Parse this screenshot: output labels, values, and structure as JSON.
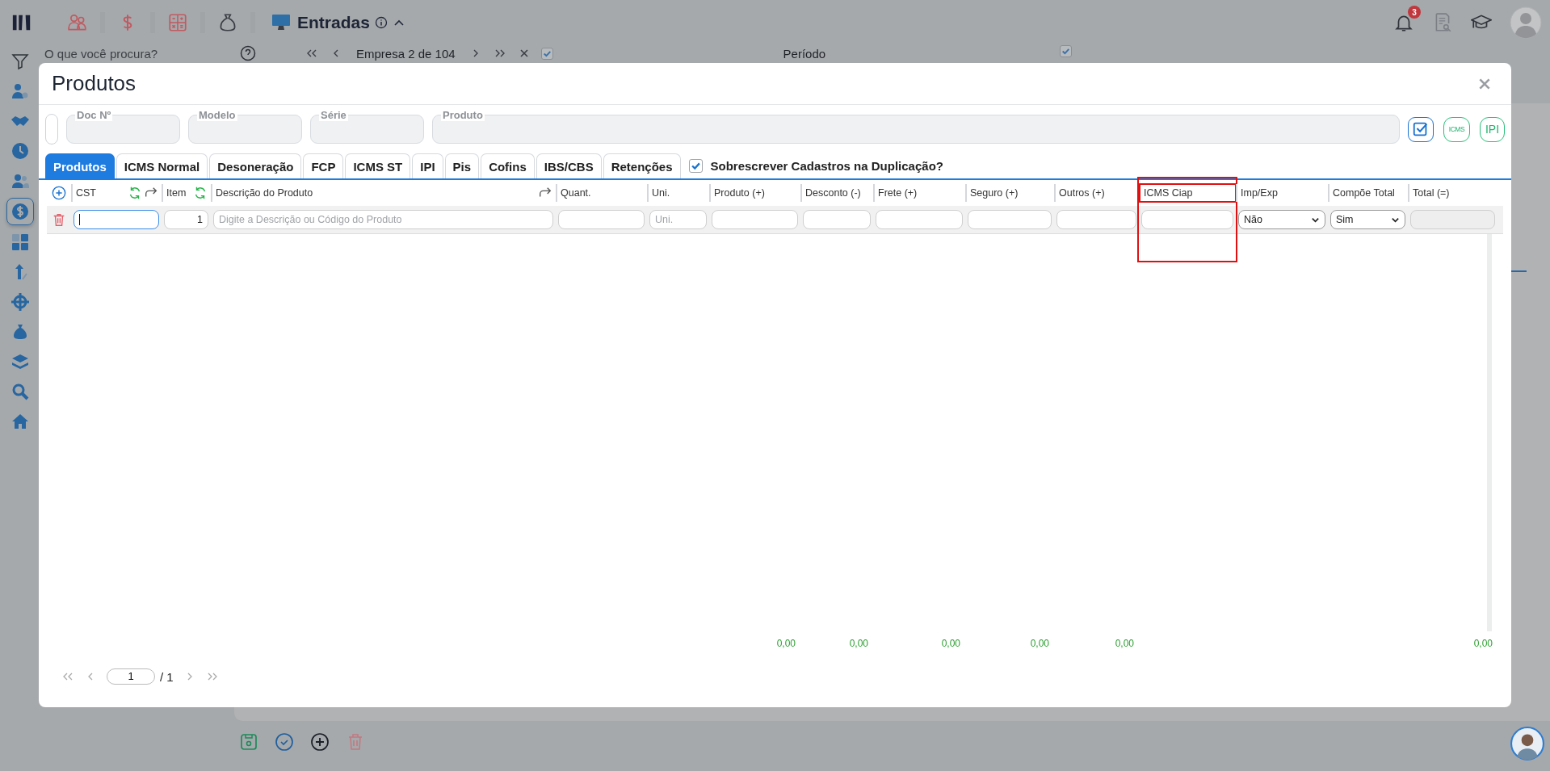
{
  "app": {
    "module_title": "Entradas",
    "search": {
      "placeholder": "O que você procura?"
    },
    "company_nav": {
      "label": "Empresa 2 de 104",
      "checked": true
    },
    "period": {
      "label": "Período",
      "checked": true
    },
    "notifications_count": "3",
    "sidebar": {
      "items": [
        {
          "selected": false
        },
        {
          "selected": false
        },
        {
          "selected": false
        },
        {
          "selected": false
        },
        {
          "selected": true
        },
        {
          "selected": false
        },
        {
          "selected": false
        },
        {
          "selected": false
        },
        {
          "selected": false
        },
        {
          "selected": false
        },
        {
          "selected": false
        },
        {
          "selected": false
        }
      ]
    }
  },
  "modal": {
    "title": "Produtos",
    "fields": [
      {
        "label": "Doc Nº"
      },
      {
        "label": "Modelo"
      },
      {
        "label": "Série"
      },
      {
        "label": "Produto"
      }
    ],
    "action_buttons": [
      {
        "kind": "check"
      },
      {
        "kind": "text",
        "label": "ICMS"
      },
      {
        "kind": "text",
        "label": "IPI"
      }
    ],
    "tabs": [
      {
        "label": "Produtos",
        "selected": true
      },
      {
        "label": "ICMS Normal",
        "selected": false
      },
      {
        "label": "Desoneração",
        "selected": false
      },
      {
        "label": "FCP",
        "selected": false
      },
      {
        "label": "ICMS ST",
        "selected": false
      },
      {
        "label": "IPI",
        "selected": false
      },
      {
        "label": "Pis",
        "selected": false
      },
      {
        "label": "Cofins",
        "selected": false
      },
      {
        "label": "IBS/CBS",
        "selected": false
      },
      {
        "label": "Retenções",
        "selected": false
      }
    ],
    "overwrite_checkbox": {
      "label": "Sobrescrever Cadastros na Duplicação?",
      "checked": true
    },
    "columns": [
      {
        "label": "CST",
        "highlighted": false
      },
      {
        "label": "Item",
        "highlighted": false
      },
      {
        "label": "Descrição do Produto",
        "highlighted": false
      },
      {
        "label": "Quant.",
        "highlighted": false
      },
      {
        "label": "Uni.",
        "highlighted": false
      },
      {
        "label": "Produto (+)",
        "highlighted": false,
        "total": "0,00"
      },
      {
        "label": "Desconto (-)",
        "highlighted": false,
        "total": "0,00"
      },
      {
        "label": "Frete (+)",
        "highlighted": false,
        "total": "0,00"
      },
      {
        "label": "Seguro (+)",
        "highlighted": false,
        "total": "0,00"
      },
      {
        "label": "Outros (+)",
        "highlighted": false,
        "total": "0,00"
      },
      {
        "label": "ICMS Ciap",
        "highlighted": true
      },
      {
        "label": "Imp/Exp",
        "highlighted": false
      },
      {
        "label": "Compõe Total",
        "highlighted": false
      },
      {
        "label": "Total (=)",
        "highlighted": false,
        "total": "0,00"
      }
    ],
    "row": {
      "cells": [
        {
          "kind": "input",
          "focused": true
        },
        {
          "kind": "number",
          "value": "1"
        },
        {
          "kind": "input",
          "placeholder": "Digite a Descrição ou Código do Produto"
        },
        {
          "kind": "input"
        },
        {
          "kind": "input",
          "placeholder": "Uni."
        },
        {
          "kind": "input"
        },
        {
          "kind": "input"
        },
        {
          "kind": "input"
        },
        {
          "kind": "input"
        },
        {
          "kind": "input"
        },
        {
          "kind": "input"
        },
        {
          "kind": "select",
          "value": "Não"
        },
        {
          "kind": "select",
          "value": "Sim"
        },
        {
          "kind": "readonly"
        }
      ]
    },
    "pagination": {
      "page": "1",
      "of": "/ 1"
    }
  }
}
